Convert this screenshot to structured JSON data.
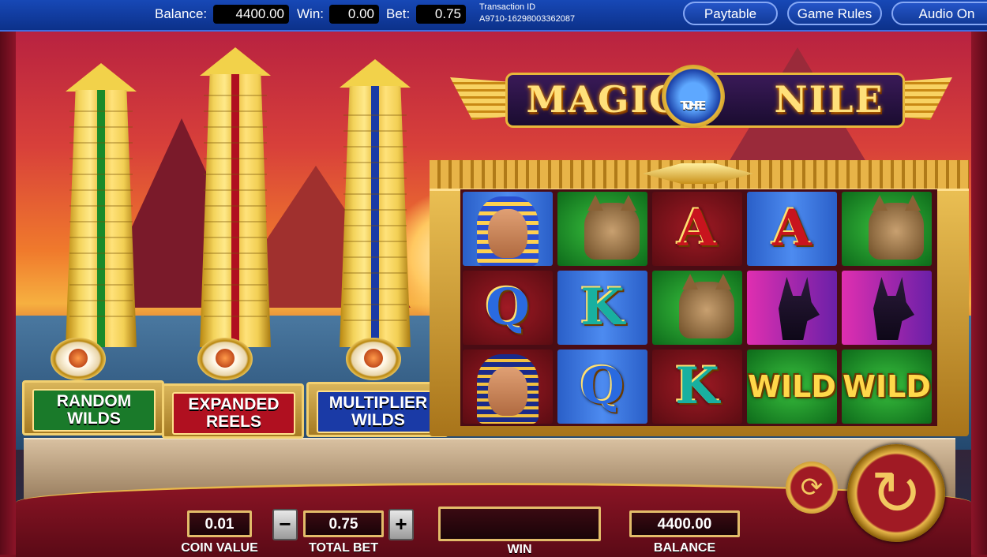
{
  "topbar": {
    "balance_label": "Balance:",
    "balance_value": "4400.00",
    "win_label": "Win:",
    "win_value": "0.00",
    "bet_label": "Bet:",
    "bet_value": "0.75",
    "transaction_label": "Transaction ID",
    "transaction_id": "A9710-16298003362087",
    "paytable_label": "Paytable",
    "game_rules_label": "Game Rules",
    "audio_label": "Audio On"
  },
  "logo": {
    "title_left": "MAGIC",
    "medallion_line1": "OF",
    "medallion_line2": "THE",
    "title_right": "NILE"
  },
  "features": [
    {
      "label_line1": "RANDOM",
      "label_line2": "WILDS",
      "color": "#1a7a2a"
    },
    {
      "label_line1": "EXPANDED",
      "label_line2": "REELS",
      "color": "#b01020"
    },
    {
      "label_line1": "MULTIPLIER",
      "label_line2": "WILDS",
      "color": "#1a3aa6"
    }
  ],
  "reels": {
    "grid": [
      [
        {
          "symbol": "pharaoh",
          "bg": "blue"
        },
        {
          "symbol": "Q",
          "bg": "red"
        },
        {
          "symbol": "cleopatra",
          "bg": "red"
        }
      ],
      [
        {
          "symbol": "cat",
          "bg": "green"
        },
        {
          "symbol": "K",
          "bg": "blue"
        },
        {
          "symbol": "Q",
          "bg": "blue"
        }
      ],
      [
        {
          "symbol": "A",
          "bg": "red"
        },
        {
          "symbol": "cat",
          "bg": "green"
        },
        {
          "symbol": "K",
          "bg": "red"
        }
      ],
      [
        {
          "symbol": "A",
          "bg": "blue"
        },
        {
          "symbol": "anubis",
          "bg": "magenta"
        },
        {
          "symbol": "WILD",
          "bg": "green"
        }
      ],
      [
        {
          "symbol": "cat",
          "bg": "green"
        },
        {
          "symbol": "anubis",
          "bg": "magenta"
        },
        {
          "symbol": "WILD",
          "bg": "green"
        }
      ]
    ]
  },
  "controls": {
    "coin_value": "0.01",
    "coin_value_label": "COIN VALUE",
    "decrease_symbol": "−",
    "total_bet": "0.75",
    "total_bet_label": "TOTAL BET",
    "increase_symbol": "+",
    "win_value": "",
    "win_label": "WIN",
    "balance_value": "4400.00",
    "balance_label": "BALANCE",
    "autoplay_icon": "autoplay-icon",
    "spin_icon": "spin-icon"
  }
}
